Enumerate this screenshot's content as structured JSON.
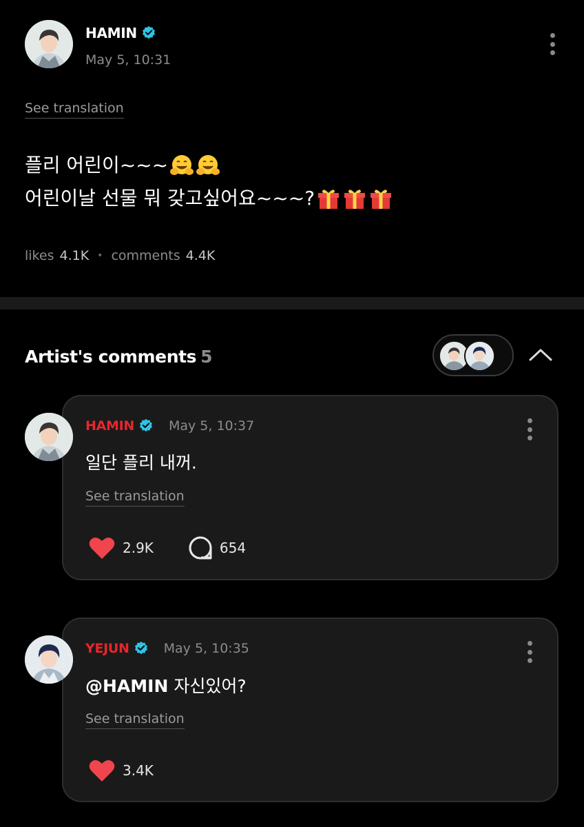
{
  "post": {
    "author": "HAMIN",
    "time": "May 5, 10:31",
    "see_translation": "See translation",
    "line1": "플리 어린이~~~",
    "line2": "어린이날 선물 뭐 갖고싶어요~~~?",
    "line1_emojis": [
      "hugging-face",
      "hugging-face"
    ],
    "line2_emojis": [
      "gift",
      "gift",
      "gift"
    ],
    "likes_label": "likes",
    "likes_count": "4.1K",
    "comments_label": "comments",
    "comments_count": "4.4K"
  },
  "artist_comments": {
    "title": "Artist's comments",
    "count": "5"
  },
  "comments": [
    {
      "author": "HAMIN",
      "time": "May 5, 10:37",
      "text": "일단 플리 내꺼.",
      "see_translation": "See translation",
      "likes": "2.9K",
      "replies": "654"
    },
    {
      "author": "YEJUN",
      "time": "May 5, 10:35",
      "mention": "@HAMIN",
      "text": " 자신있어?",
      "see_translation": "See translation",
      "likes": "3.4K"
    }
  ],
  "colors": {
    "background": "#000000",
    "card": "#1a1a1a",
    "author_red": "#e8262b",
    "verified_cyan": "#2ec4e6",
    "heart": "#f0454d",
    "muted": "#8c8c8c"
  }
}
